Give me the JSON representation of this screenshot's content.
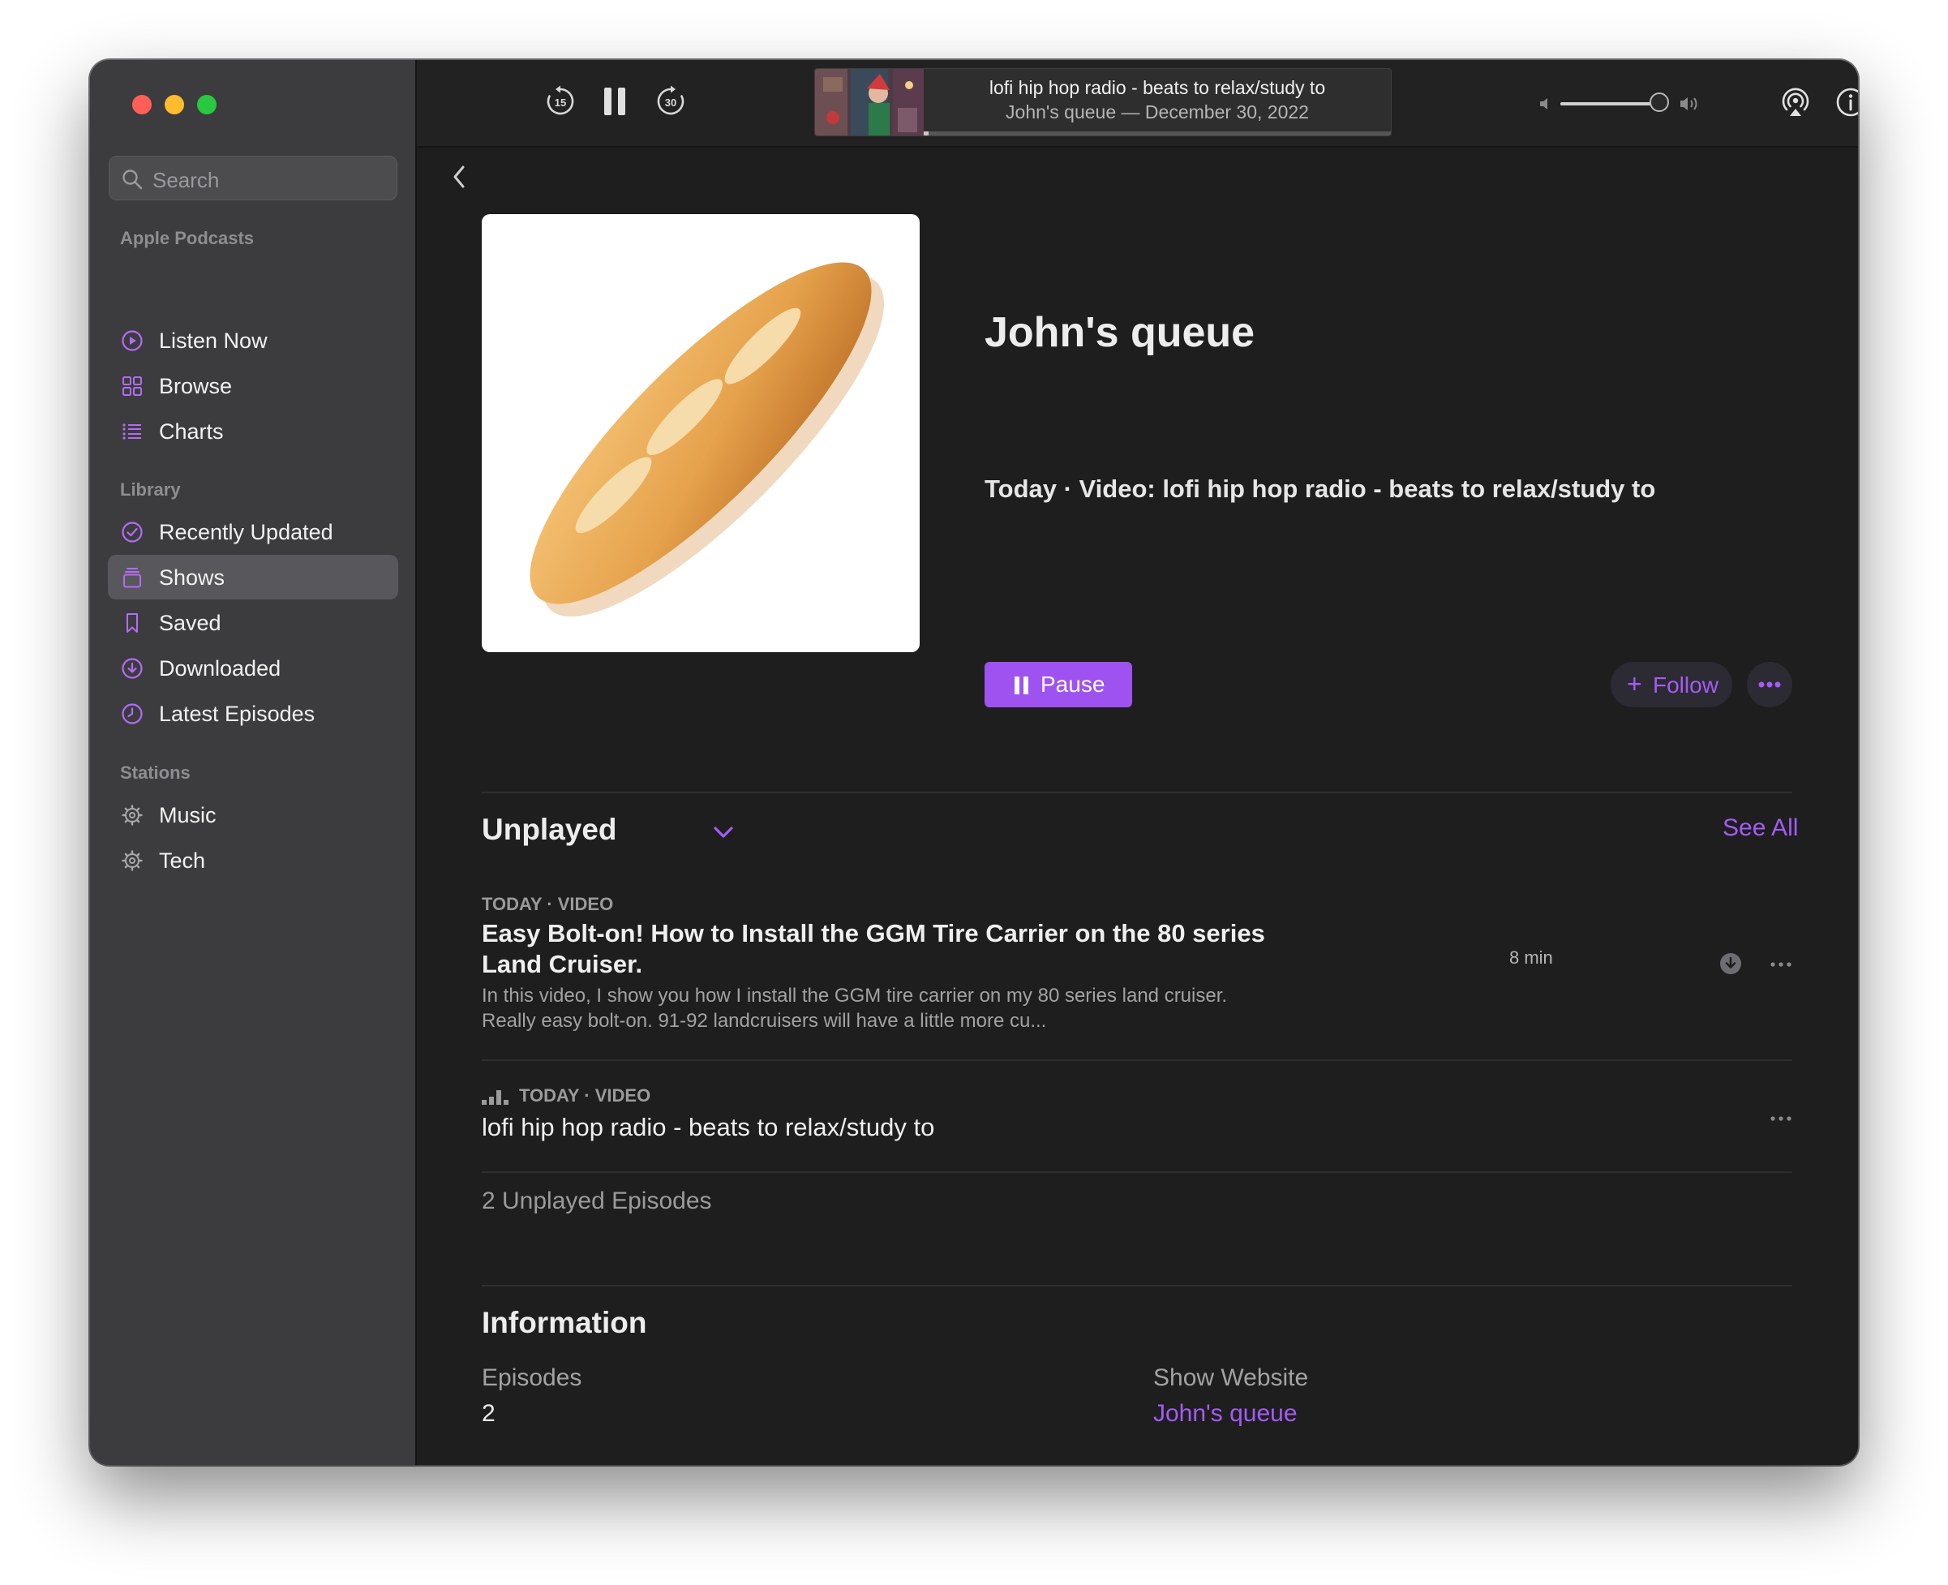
{
  "sidebar": {
    "search_placeholder": "Search",
    "sections": [
      {
        "title": "Apple Podcasts",
        "items": [
          {
            "label": "Listen Now",
            "icon": "play-circle-icon"
          },
          {
            "label": "Browse",
            "icon": "grid-icon"
          },
          {
            "label": "Charts",
            "icon": "list-icon"
          }
        ]
      },
      {
        "title": "Library",
        "items": [
          {
            "label": "Recently Updated",
            "icon": "checkmark-circle-icon"
          },
          {
            "label": "Shows",
            "icon": "stack-icon",
            "selected": true
          },
          {
            "label": "Saved",
            "icon": "bookmark-icon"
          },
          {
            "label": "Downloaded",
            "icon": "download-circle-icon"
          },
          {
            "label": "Latest Episodes",
            "icon": "clock-icon"
          }
        ]
      },
      {
        "title": "Stations",
        "items": [
          {
            "label": "Music",
            "icon": "gear-icon"
          },
          {
            "label": "Tech",
            "icon": "gear-icon"
          }
        ]
      }
    ]
  },
  "player": {
    "skip_back_seconds": "15",
    "skip_forward_seconds": "30",
    "now_playing_title": "lofi hip hop radio - beats to relax/study to",
    "now_playing_subtitle": "John's queue — December 30, 2022",
    "progress_fraction": 0.01,
    "volume_fraction": 0.9
  },
  "show": {
    "title": "John's queue",
    "latest_line": "Today · Video: lofi hip hop radio - beats to relax/study to",
    "pause_label": "Pause",
    "follow_label": "Follow",
    "artwork_icon": "baguette-bread-icon"
  },
  "unplayed": {
    "heading": "Unplayed",
    "see_all": "See All",
    "episodes": [
      {
        "meta": "TODAY · VIDEO",
        "title": "Easy Bolt-on! How to Install the GGM Tire Carrier on the 80 series Land Cruiser.",
        "description": "In this video, I show you how I install the GGM tire carrier on my 80 series land cruiser. Really easy bolt-on. 91-92 landcruisers will have a little more cu...",
        "duration": "8 min"
      },
      {
        "meta": "TODAY · VIDEO",
        "title": "lofi hip hop radio - beats to relax/study to",
        "playing": true
      }
    ],
    "count_text": "2 Unplayed Episodes"
  },
  "information": {
    "heading": "Information",
    "episodes_label": "Episodes",
    "episodes_value": "2",
    "website_label": "Show Website",
    "website_value": "John's queue"
  },
  "colors": {
    "accent": "#9e52f0",
    "accent_text": "#a45cf3",
    "sidebar_bg": "#3c3c3e",
    "content_bg": "#1e1e1e"
  }
}
